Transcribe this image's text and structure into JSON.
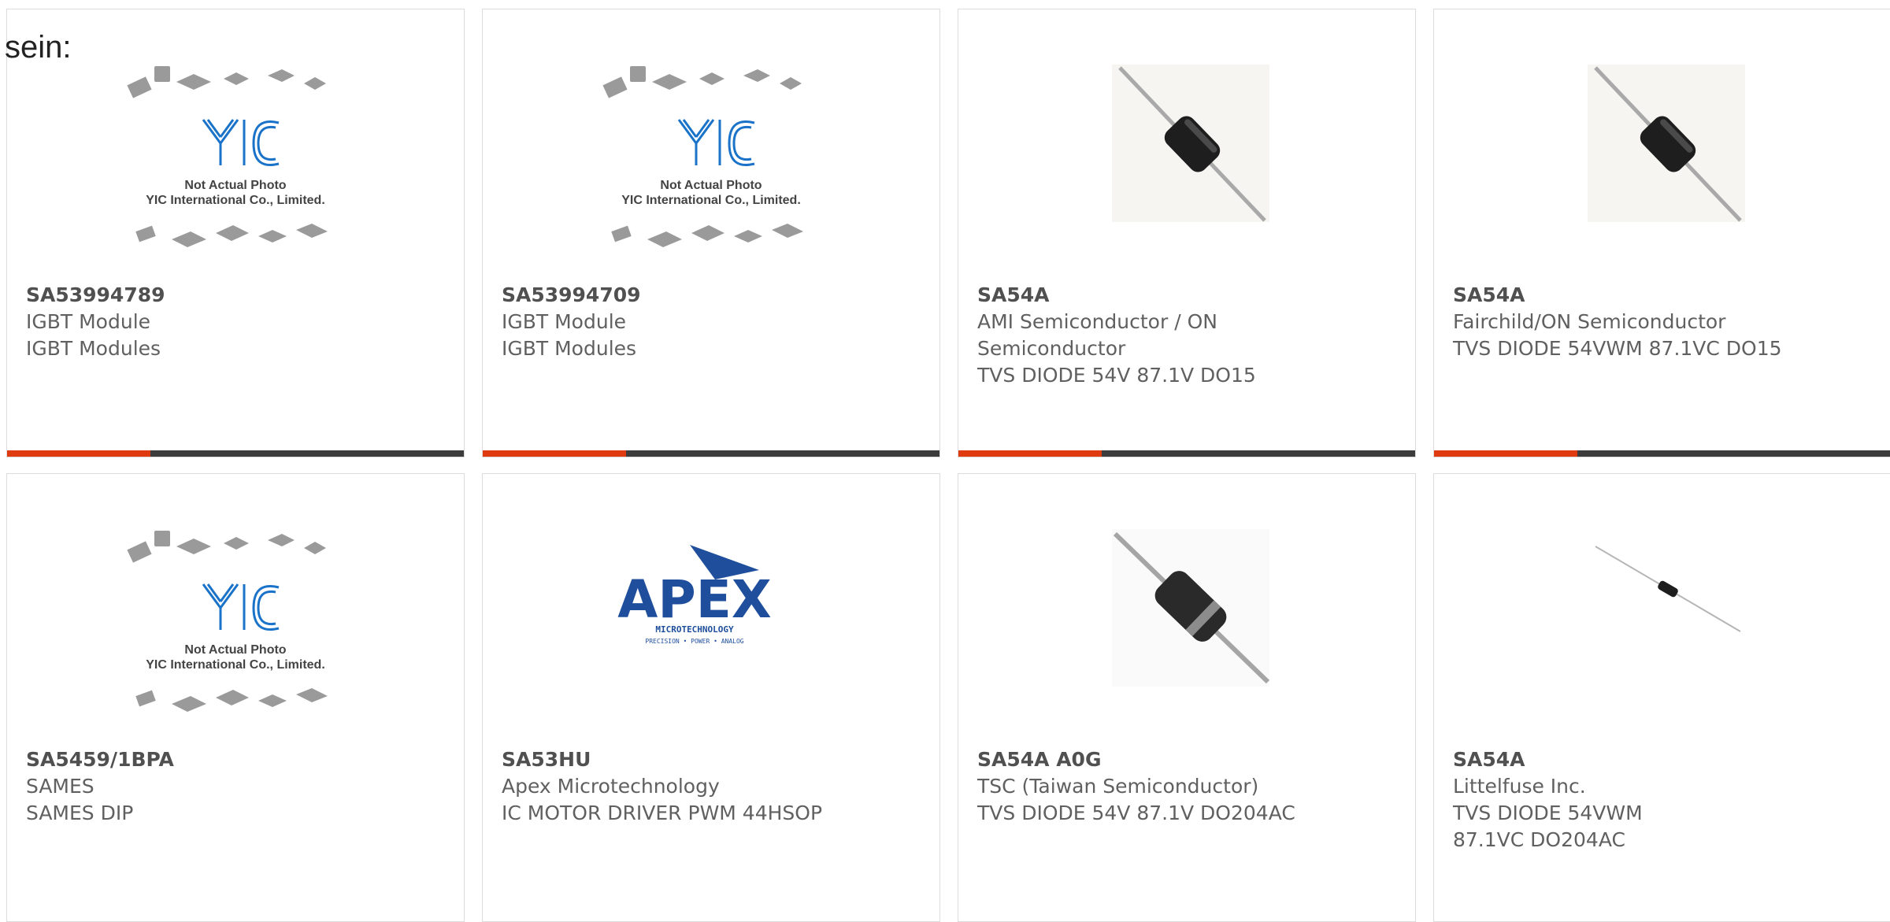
{
  "page_fragment": "sein:",
  "logos": {
    "yic_monogram": "YIC",
    "yic_caption_1": "Not Actual Photo",
    "yic_caption_2": "YIC International Co., Limited.",
    "apex_word": "APEX",
    "apex_sub": "MICROTECHNOLOGY",
    "apex_tag": "PRECISION • POWER • ANALOG"
  },
  "colors": {
    "accent": "#e03a10",
    "bar": "#3c3c3c",
    "yic_blue": "#1a73c8",
    "apex_blue": "#1f4f9c"
  },
  "products": [
    {
      "part": "SA53994789",
      "manufacturer": "IGBT Module",
      "description": "IGBT Modules",
      "image": "yic-placeholder-icon"
    },
    {
      "part": "SA53994709",
      "manufacturer": "IGBT Module",
      "description": "IGBT Modules",
      "image": "yic-placeholder-icon"
    },
    {
      "part": "SA54A",
      "manufacturer": "AMI Semiconductor / ON Semiconductor",
      "description": "TVS DIODE 54V 87.1V DO15",
      "image": "axial-diode-icon"
    },
    {
      "part": "SA54A",
      "manufacturer": "Fairchild/ON Semiconductor",
      "description": "TVS DIODE 54VWM 87.1VC DO15",
      "image": "axial-diode-icon"
    },
    {
      "part": "SA5459/1BPA",
      "manufacturer": "SAMES",
      "description": "SAMES DIP",
      "image": "yic-placeholder-icon"
    },
    {
      "part": "SA53HU",
      "manufacturer": "Apex Microtechnology",
      "description": "IC MOTOR DRIVER PWM 44HSOP",
      "image": "apex-logo-icon"
    },
    {
      "part": "SA54A A0G",
      "manufacturer": "TSC (Taiwan Semiconductor)",
      "description": "TVS DIODE 54V 87.1V DO204AC",
      "image": "axial-diode-icon"
    },
    {
      "part": "SA54A",
      "manufacturer": "Littelfuse Inc.",
      "description": "TVS DIODE 54VWM 87.1VC DO204AC",
      "image": "small-axial-diode-icon"
    }
  ]
}
